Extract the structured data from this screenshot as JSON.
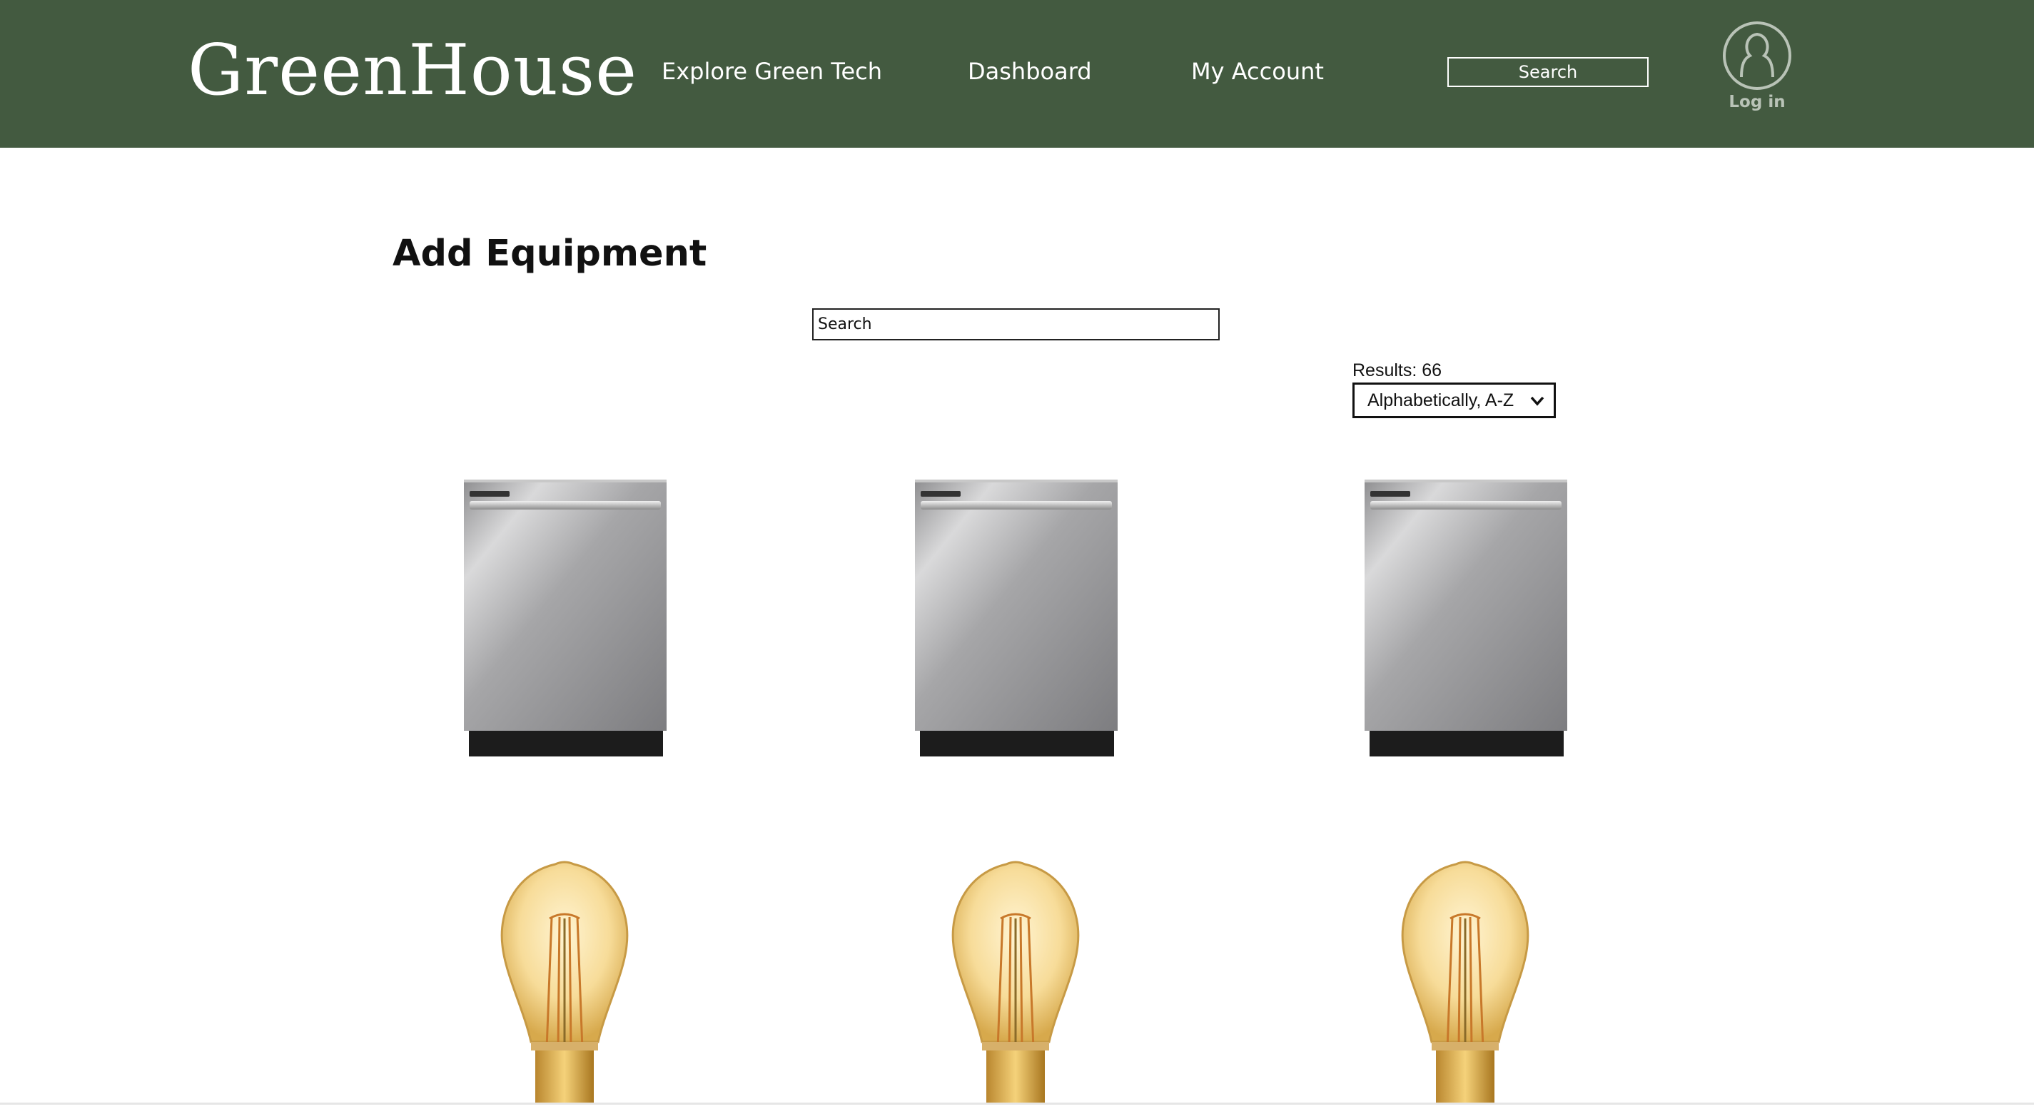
{
  "header": {
    "logo": "GreenHouse",
    "nav": [
      {
        "label": "Explore Green Tech"
      },
      {
        "label": "Dashboard"
      },
      {
        "label": "My Account"
      }
    ],
    "search_label": "Search",
    "login_label": "Log in",
    "background_color": "#435a40"
  },
  "main": {
    "title": "Add Equipment",
    "search_placeholder": "Search",
    "results_text": "Results: 66",
    "sort_selected": "Alphabetically, A-Z"
  },
  "products": [
    {
      "type": "dishwasher"
    },
    {
      "type": "dishwasher"
    },
    {
      "type": "dishwasher"
    },
    {
      "type": "light-bulb"
    },
    {
      "type": "light-bulb"
    },
    {
      "type": "light-bulb"
    }
  ]
}
